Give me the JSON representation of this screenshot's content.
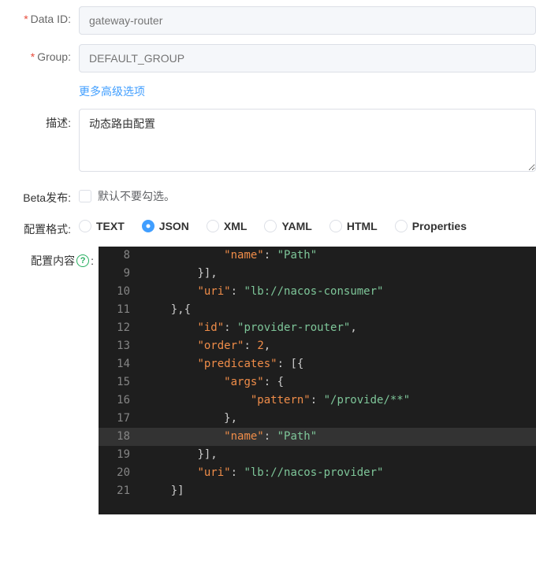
{
  "form": {
    "dataId": {
      "label": "Data ID:",
      "required": true,
      "placeholder": "gateway-router",
      "value": ""
    },
    "group": {
      "label": "Group:",
      "required": true,
      "placeholder": "DEFAULT_GROUP",
      "value": ""
    },
    "advancedLink": "更多高级选项",
    "description": {
      "label": "描述:",
      "value": "动态路由配置"
    },
    "beta": {
      "label": "Beta发布:",
      "checked": false,
      "text": "默认不要勾选。"
    },
    "format": {
      "label": "配置格式:",
      "selected": "JSON",
      "options": [
        "TEXT",
        "JSON",
        "XML",
        "YAML",
        "HTML",
        "Properties"
      ]
    },
    "content": {
      "label": "配置内容",
      "helpGlyph": "?",
      "colon": ":"
    }
  },
  "code": {
    "firstLineNumber": 8,
    "highlightLine": 18,
    "lines": [
      [
        3,
        [
          [
            "key",
            "\"name\""
          ],
          [
            "pun",
            ": "
          ],
          [
            "str",
            "\"Path\""
          ]
        ]
      ],
      [
        2,
        [
          [
            "pun",
            "}],"
          ]
        ]
      ],
      [
        2,
        [
          [
            "key",
            "\"uri\""
          ],
          [
            "pun",
            ": "
          ],
          [
            "str",
            "\"lb://nacos-consumer\""
          ]
        ]
      ],
      [
        1,
        [
          [
            "pun",
            "},{"
          ]
        ]
      ],
      [
        2,
        [
          [
            "key",
            "\"id\""
          ],
          [
            "pun",
            ": "
          ],
          [
            "str",
            "\"provider-router\""
          ],
          [
            "pun",
            ","
          ]
        ]
      ],
      [
        2,
        [
          [
            "key",
            "\"order\""
          ],
          [
            "pun",
            ": "
          ],
          [
            "num",
            "2"
          ],
          [
            "pun",
            ","
          ]
        ]
      ],
      [
        2,
        [
          [
            "key",
            "\"predicates\""
          ],
          [
            "pun",
            ": [{"
          ]
        ]
      ],
      [
        3,
        [
          [
            "key",
            "\"args\""
          ],
          [
            "pun",
            ": {"
          ]
        ]
      ],
      [
        4,
        [
          [
            "key",
            "\"pattern\""
          ],
          [
            "pun",
            ": "
          ],
          [
            "str",
            "\"/provide/**\""
          ]
        ]
      ],
      [
        3,
        [
          [
            "pun",
            "},"
          ]
        ]
      ],
      [
        3,
        [
          [
            "key",
            "\"name\""
          ],
          [
            "pun",
            ": "
          ],
          [
            "str",
            "\"Path\""
          ]
        ]
      ],
      [
        2,
        [
          [
            "pun",
            "}],"
          ]
        ]
      ],
      [
        2,
        [
          [
            "key",
            "\"uri\""
          ],
          [
            "pun",
            ": "
          ],
          [
            "str",
            "\"lb://nacos-provider\""
          ]
        ]
      ],
      [
        1,
        [
          [
            "pun",
            "}]"
          ]
        ]
      ]
    ]
  }
}
